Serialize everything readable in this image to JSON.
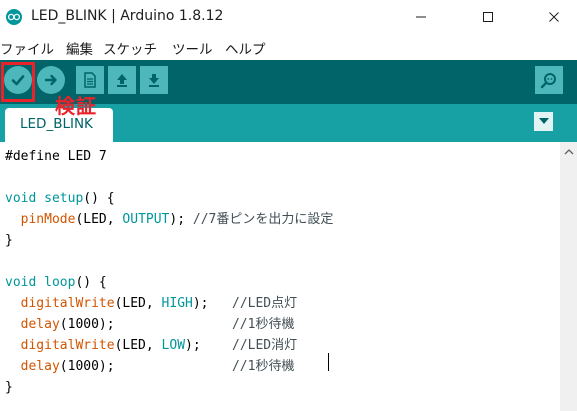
{
  "window": {
    "title": "LED_BLINK | Arduino 1.8.12"
  },
  "menu": [
    "ファイル",
    "編集",
    "スケッチ",
    "ツール",
    "ヘルプ"
  ],
  "toolbar": {
    "buttons": [
      "verify",
      "upload",
      "new",
      "open",
      "save",
      "serial-monitor"
    ],
    "annotation": "検証"
  },
  "tabs": [
    {
      "label": "LED_BLINK",
      "active": true
    }
  ],
  "editor": {
    "lines": [
      [
        {
          "t": "#define LED 7",
          "c": "pl"
        }
      ],
      [],
      [
        {
          "t": "void",
          "c": "kw"
        },
        {
          "t": " ",
          "c": "pl"
        },
        {
          "t": "setup",
          "c": "kw"
        },
        {
          "t": "() {",
          "c": "pl"
        }
      ],
      [
        {
          "t": "  ",
          "c": "pl"
        },
        {
          "t": "pinMode",
          "c": "fn"
        },
        {
          "t": "(LED, ",
          "c": "pl"
        },
        {
          "t": "OUTPUT",
          "c": "cn"
        },
        {
          "t": "); ",
          "c": "pl"
        },
        {
          "t": "//7番ピンを出力に設定",
          "c": "cm"
        }
      ],
      [
        {
          "t": "}",
          "c": "pl"
        }
      ],
      [],
      [
        {
          "t": "void",
          "c": "kw"
        },
        {
          "t": " ",
          "c": "pl"
        },
        {
          "t": "loop",
          "c": "kw"
        },
        {
          "t": "() {",
          "c": "pl"
        }
      ],
      [
        {
          "t": "  ",
          "c": "pl"
        },
        {
          "t": "digitalWrite",
          "c": "fn"
        },
        {
          "t": "(LED, ",
          "c": "pl"
        },
        {
          "t": "HIGH",
          "c": "cn"
        },
        {
          "t": ");   ",
          "c": "pl"
        },
        {
          "t": "//LED点灯",
          "c": "cm"
        }
      ],
      [
        {
          "t": "  ",
          "c": "pl"
        },
        {
          "t": "delay",
          "c": "fn"
        },
        {
          "t": "(1000);               ",
          "c": "pl"
        },
        {
          "t": "//1秒待機",
          "c": "cm"
        }
      ],
      [
        {
          "t": "  ",
          "c": "pl"
        },
        {
          "t": "digitalWrite",
          "c": "fn"
        },
        {
          "t": "(LED, ",
          "c": "pl"
        },
        {
          "t": "LOW",
          "c": "cn"
        },
        {
          "t": ");    ",
          "c": "pl"
        },
        {
          "t": "//LED消灯",
          "c": "cm"
        }
      ],
      [
        {
          "t": "  ",
          "c": "pl"
        },
        {
          "t": "delay",
          "c": "fn"
        },
        {
          "t": "(1000);               ",
          "c": "pl"
        },
        {
          "t": "//1秒待機",
          "c": "cm"
        }
      ],
      [
        {
          "t": "}",
          "c": "pl"
        }
      ]
    ]
  },
  "colors": {
    "toolbar_bg": "#006468",
    "tabbar_bg": "#17a1a5",
    "button_bg": "#4db7bb",
    "highlight": "#e8232b",
    "keyword": "#00979c",
    "function": "#d35400"
  }
}
